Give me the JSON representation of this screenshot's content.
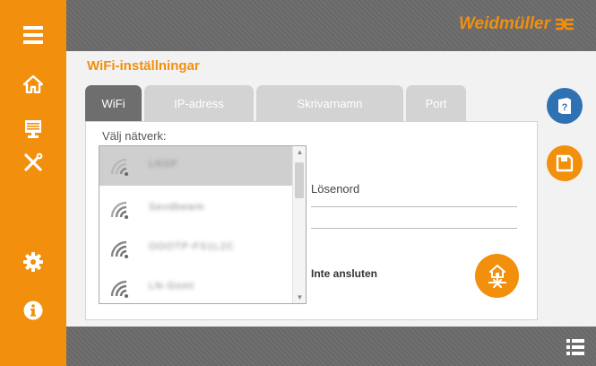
{
  "header": {
    "brand": "Weidmüller"
  },
  "page": {
    "title": "WiFi-inställningar"
  },
  "tabs": [
    {
      "label": "WiFi",
      "active": true
    },
    {
      "label": "IP-adress",
      "active": false
    },
    {
      "label": "Skrivarnamn",
      "active": false
    },
    {
      "label": "Port",
      "active": false
    }
  ],
  "networks": {
    "label": "Välj nätverk:",
    "items": [
      {
        "ssid": "LNSP",
        "selected": true
      },
      {
        "ssid": "Sevdbewm",
        "selected": false
      },
      {
        "ssid": "OOOTP-FS1L2C",
        "selected": false
      },
      {
        "ssid": "LN-Gsmt",
        "selected": false
      }
    ]
  },
  "password": {
    "label": "Lösenord",
    "value": ""
  },
  "status": {
    "text": "Inte ansluten"
  },
  "sidebar": {
    "icons": [
      "menu-icon",
      "home-icon",
      "printer-display-icon",
      "tools-icon",
      "settings-gear-icon",
      "info-icon"
    ]
  },
  "colors": {
    "accent": "#f28f0c",
    "bar": "#6b6b6b",
    "help": "#2e72b4",
    "tab_active": "#6e6e6e",
    "tab_inactive": "#d3d3d3"
  }
}
